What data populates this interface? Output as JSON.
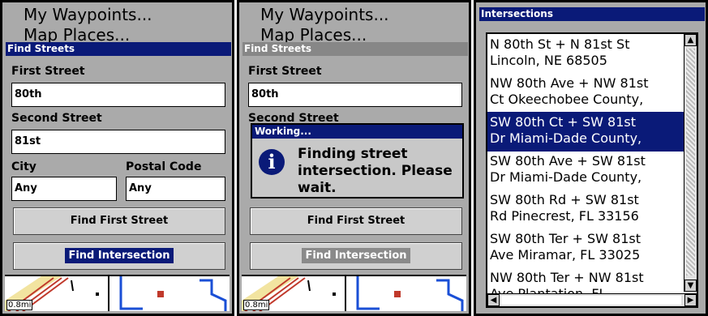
{
  "left_panel": {
    "menu_items": [
      "My Waypoints...",
      "Map Places..."
    ],
    "window_title": "Find Streets",
    "first_street_label": "First Street",
    "first_street_value": "80th",
    "second_street_label": "Second Street",
    "second_street_value": "81st",
    "city_label": "City",
    "city_value": "Any",
    "postal_label": "Postal Code",
    "postal_value": "Any",
    "find_first_label": "Find First Street",
    "find_intersection_label": "Find Intersection",
    "map_scale": "0.8mi"
  },
  "middle_panel": {
    "menu_items": [
      "My Waypoints...",
      "Map Places..."
    ],
    "window_title": "Find Streets",
    "first_street_label": "First Street",
    "first_street_value": "80th",
    "second_street_label": "Second Street",
    "dialog_title": "Working...",
    "dialog_message": "Finding street intersection. Please wait.",
    "find_first_label": "Find First Street",
    "find_intersection_label": "Find Intersection",
    "map_scale": "0.8mi"
  },
  "right_panel": {
    "window_title": "Intersections",
    "results": [
      {
        "line1": "N 80th St + N 81st St",
        "line2": "Lincoln, NE  68505",
        "selected": false
      },
      {
        "line1": "NW 80th Ave + NW 81st",
        "line2": "Ct Okeechobee County,",
        "selected": false
      },
      {
        "line1": "SW 80th Ct + SW 81st",
        "line2": "Dr Miami-Dade County,",
        "selected": true
      },
      {
        "line1": "SW 80th Ave + SW 81st",
        "line2": "Dr Miami-Dade County,",
        "selected": false
      },
      {
        "line1": "SW 80th Rd + SW 81st",
        "line2": "Rd Pinecrest, FL  33156",
        "selected": false
      },
      {
        "line1": "SW 80th Ter + SW 81st",
        "line2": "Ave Miramar, FL  33025",
        "selected": false
      },
      {
        "line1": "NW 80th Ter + NW 81st",
        "line2": "Ave Plantation, FL",
        "selected": false
      }
    ],
    "icons": [
      "scroll-up-icon",
      "scroll-down-icon",
      "scroll-left-icon",
      "scroll-right-icon"
    ]
  },
  "colors": {
    "title_blue": "#0a1a78",
    "panel_gray": "#aaaaaa"
  }
}
